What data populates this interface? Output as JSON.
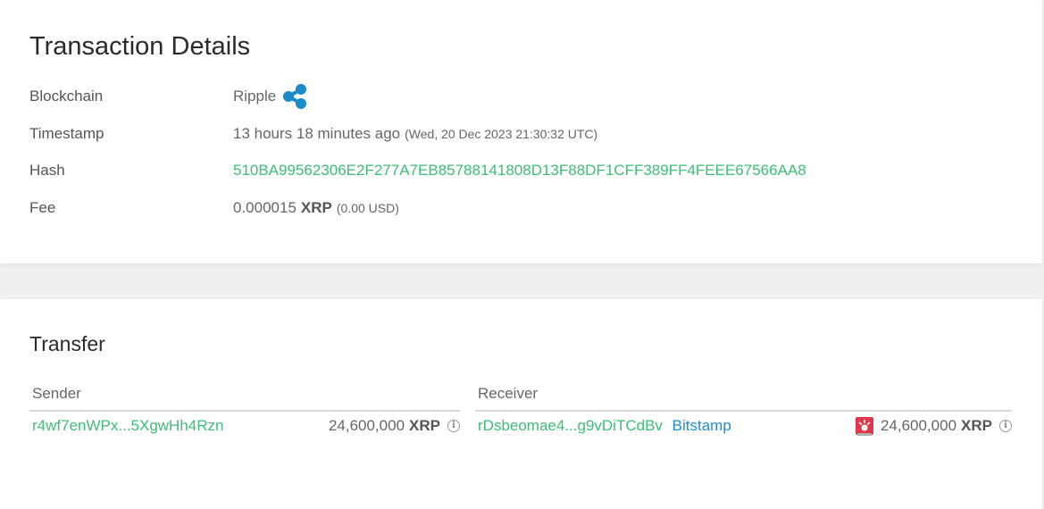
{
  "details": {
    "title": "Transaction Details",
    "rows": {
      "blockchain": {
        "label": "Blockchain",
        "value": "Ripple",
        "icon": "ripple-logo-icon",
        "icon_color": "#1a8bc9"
      },
      "timestamp": {
        "label": "Timestamp",
        "value": "13 hours 18 minutes ago",
        "detail": "(Wed, 20 Dec 2023 21:30:32 UTC)"
      },
      "hash": {
        "label": "Hash",
        "value": "510BA99562306E2F277A7EB85788141808D13F88DF1CFF389FF4FEEE67566AA8"
      },
      "fee": {
        "label": "Fee",
        "amount": "0.000015",
        "unit": "XRP",
        "fiat": "(0.00 USD)"
      }
    }
  },
  "transfer": {
    "title": "Transfer",
    "sender": {
      "header": "Sender",
      "address": "r4wf7enWPx...5XgwHh4Rzn",
      "amount": "24,600,000",
      "unit": "XRP",
      "info_icon": "i"
    },
    "receiver": {
      "header": "Receiver",
      "address": "rDsbeomae4...g9vDiTCdBv",
      "tag": "Bitstamp",
      "alert_icon": "siren-icon",
      "amount": "24,600,000",
      "unit": "XRP",
      "info_icon": "i"
    }
  },
  "colors": {
    "link_green": "#3cbf75",
    "link_blue": "#1c8fd8",
    "ripple_blue": "#1a8bc9",
    "siren_red": "#e2364b"
  }
}
